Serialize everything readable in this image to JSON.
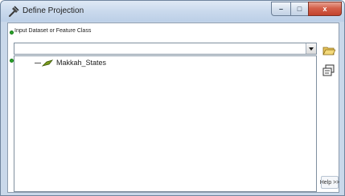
{
  "window": {
    "title": "Define Projection",
    "controls": {
      "minimize": "–",
      "maximize": "□",
      "close": "x"
    }
  },
  "form": {
    "input_label": "Input Dataset or Feature Class",
    "input_value": "",
    "layers": [
      {
        "label": "Makkah_States",
        "icon": "polygon-layer-icon"
      }
    ]
  },
  "side_buttons": [
    {
      "icon": "open-folder-icon"
    },
    {
      "icon": "properties-icon"
    }
  ],
  "help": {
    "label": "Help >>"
  },
  "colors": {
    "title_bar": "#c8d8ec",
    "close_button": "#c3432d",
    "required_dot": "#2aa22a",
    "layer_icon": "#7a9a1a"
  }
}
